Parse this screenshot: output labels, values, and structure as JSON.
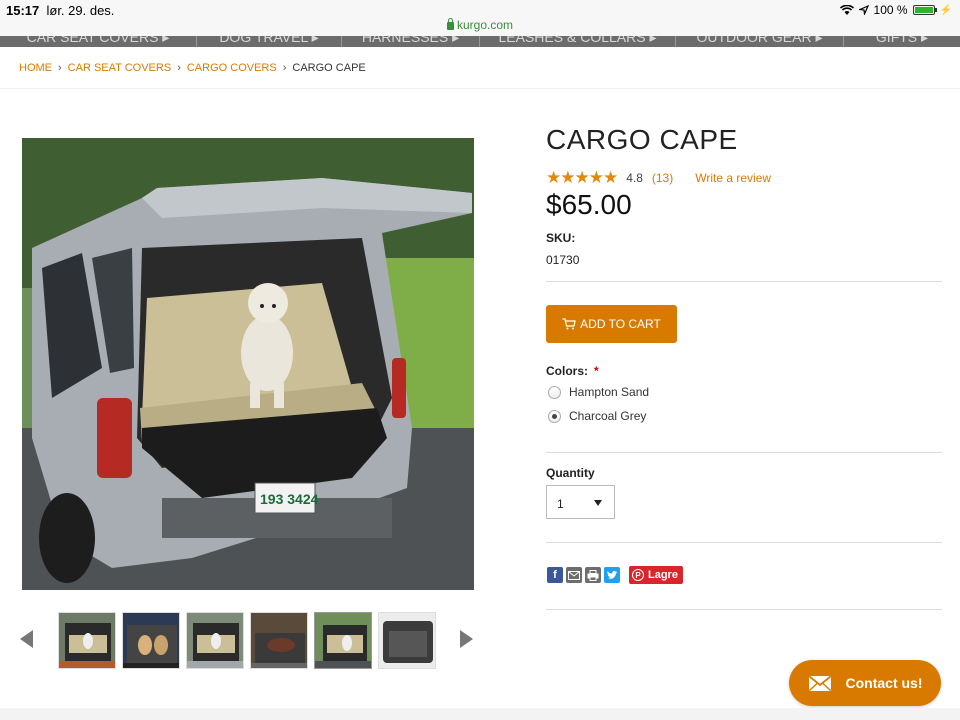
{
  "status_bar": {
    "time": "15:17",
    "date": "lør. 29. des.",
    "url": "kurgo.com",
    "battery": "100 %"
  },
  "nav": {
    "items": [
      "CAR SEAT COVERS ▸",
      "DOG TRAVEL ▸",
      "HARNESSES ▸",
      "LEASHES & COLLARS ▸",
      "OUTDOOR GEAR ▸",
      "GIFTS ▸"
    ]
  },
  "breadcrumb": {
    "items": [
      "HOME",
      "CAR SEAT COVERS",
      "CARGO COVERS"
    ],
    "current": "CARGO CAPE"
  },
  "product": {
    "title": "CARGO CAPE",
    "stars": "★★★★★",
    "rating": 4.8,
    "review_count": "(13)",
    "write_review": "Write a review",
    "price": "$65.00",
    "sku_label": "SKU:",
    "sku": "01730",
    "add_to_cart": "ADD TO CART",
    "colors_label": "Colors:",
    "required_mark": "*",
    "colors": [
      {
        "label": "Hampton Sand",
        "selected": false
      },
      {
        "label": "Charcoal Grey",
        "selected": true
      }
    ],
    "quantity_label": "Quantity",
    "quantity": "1"
  },
  "share": {
    "facebook": "f",
    "pin_label": "Lagre"
  },
  "contact": {
    "label": "Contact us!"
  },
  "colors": {
    "accent": "#d97a00",
    "nav_bg": "#6c6c6c",
    "pinterest": "#d9262b",
    "facebook": "#3b5998",
    "twitter": "#1da1f2"
  }
}
